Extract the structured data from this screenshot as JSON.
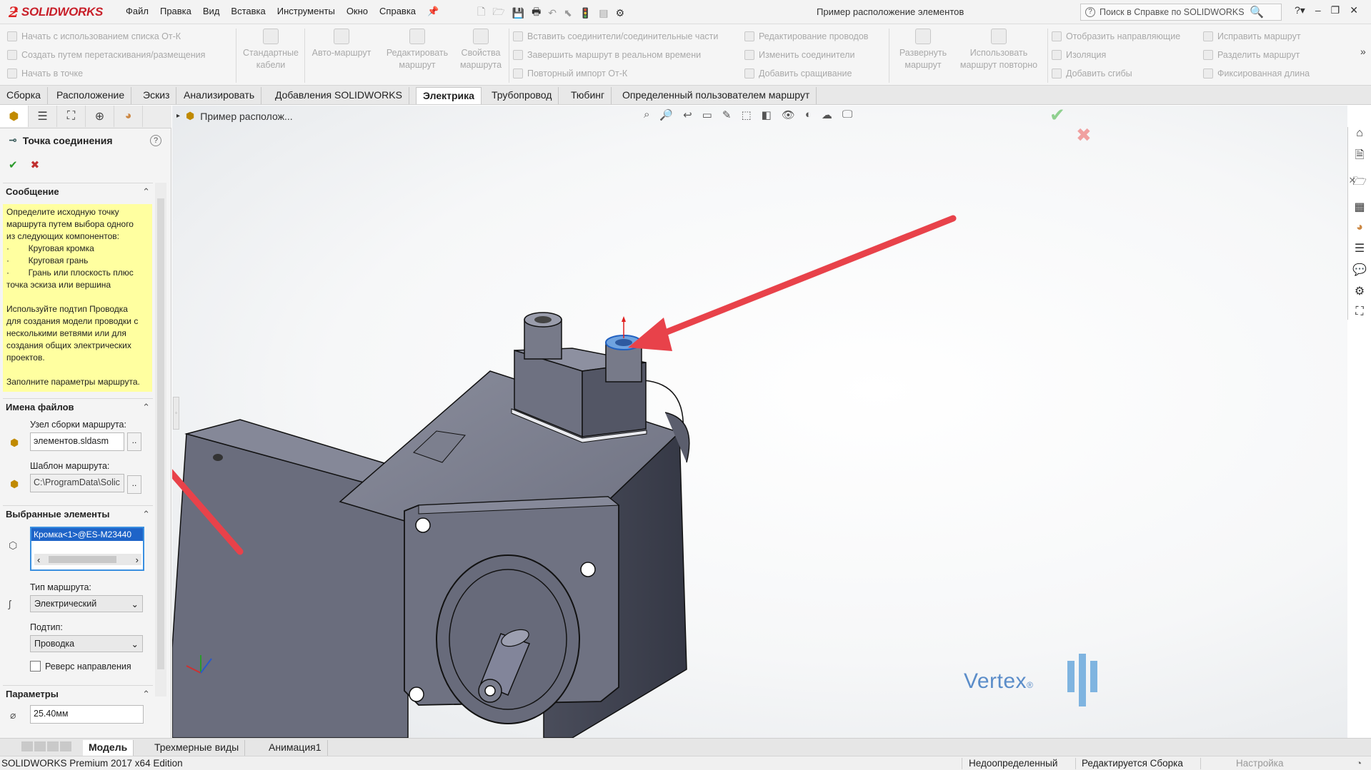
{
  "app": {
    "logo_text": "SOLIDWORKS",
    "document_title": "Пример расположение элементов",
    "help_search_placeholder": "Поиск в Справке по SOLIDWORKS"
  },
  "menu": [
    "Файл",
    "Правка",
    "Вид",
    "Вставка",
    "Инструменты",
    "Окно",
    "Справка"
  ],
  "ribbon": {
    "col1": [
      "Начать с использованием списка От-К",
      "Создать путем перетаскивания/размещения",
      "Начать в точке"
    ],
    "big1": "Стандартные кабели",
    "big2": "Авто-маршрут",
    "big3": "Редактировать маршрут",
    "big4": "Свойства маршрута",
    "col2": [
      "Вставить соединители/соединительные части",
      "Завершить маршрут в реальном времени",
      "Повторный импорт От-К"
    ],
    "col3": [
      "Редактирование проводов",
      "Изменить соединители",
      "Добавить сращивание"
    ],
    "big5": "Развернуть маршрут",
    "big6": "Использовать маршрут повторно",
    "col4": [
      "Отобразить направляющие",
      "Изоляция",
      "Добавить сгибы"
    ],
    "col5": [
      "Исправить маршрут",
      "Разделить маршрут",
      "Фиксированная длина"
    ]
  },
  "tabs": [
    "Сборка",
    "Расположение",
    "Эскиз",
    "Анализировать",
    "Добавления SOLIDWORKS",
    "Электрика",
    "Трубопровод",
    "Тюбинг",
    "Определенный пользователем маршрут"
  ],
  "active_tab": "Электрика",
  "property_manager": {
    "title": "Точка соединения",
    "help": "?",
    "ok": "✔",
    "cancel": "✖",
    "message_header": "Сообщение",
    "message_lines": [
      "Определите исходную точку",
      "маршрута путем выбора одного",
      "из следующих компонентов:",
      "·        Круговая кромка",
      "·        Круговая грань",
      "·        Грань или плоскость плюс",
      "точка эскиза или вершина",
      "",
      "Используйте подтип Проводка",
      "для создания модели проводки с",
      "несколькими ветвями или для",
      "создания общих электрических",
      "проектов.",
      "",
      "Заполните параметры маршрута."
    ],
    "filenames_header": "Имена файлов",
    "route_assembly_label": "Узел сборки маршрута:",
    "route_assembly_value": "элементов.sldasm",
    "route_template_label": "Шаблон маршрута:",
    "route_template_value": "C:\\ProgramData\\Solic",
    "dots": "..",
    "selected_header": "Выбранные элементы",
    "selected_item": "Кромка<1>@ES-M23440",
    "route_type_label": "Тип маршрута:",
    "route_type_value": "Электрический",
    "subtype_label": "Подтип:",
    "subtype_value": "Проводка",
    "reverse_label": "Реверс направления",
    "params_header": "Параметры",
    "diameter_value": "25.40мм"
  },
  "viewport": {
    "tree_label": "Пример располож...",
    "watermark": "Vertex"
  },
  "bottom_tabs": [
    "Модель",
    "Трехмерные виды",
    "Анимация1"
  ],
  "status": {
    "edition": "SOLIDWORKS Premium 2017 x64 Edition",
    "state1": "Недоопределенный",
    "state2": "Редактируется Сборка",
    "state3": "Настройка"
  },
  "colors": {
    "brand_red": "#c8202a",
    "message_yellow": "#ffffa0",
    "selection_blue": "#1e64c8",
    "arrow_red": "#e8424a",
    "model_gray": "#6e7180"
  }
}
